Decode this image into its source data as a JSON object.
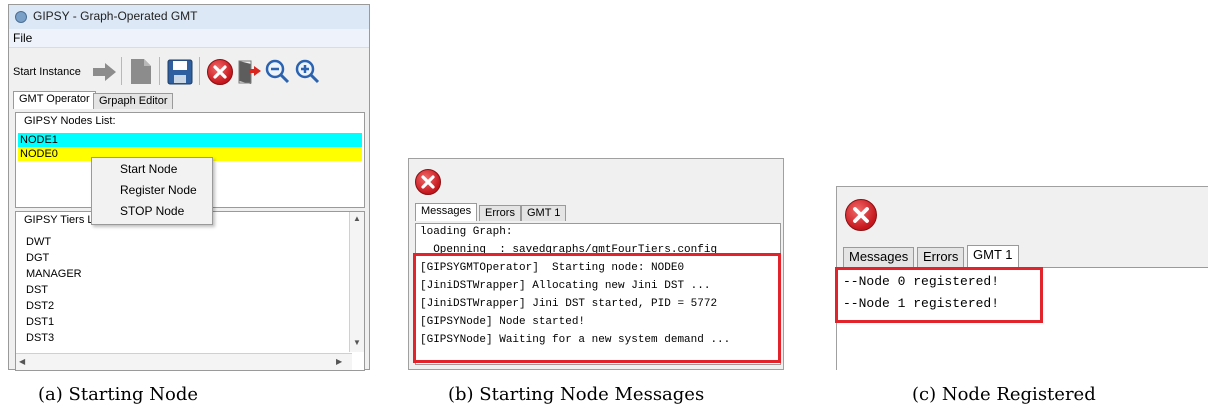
{
  "panel_a": {
    "window_title": "GIPSY - Graph-Operated GMT",
    "menu": [
      "File"
    ],
    "toolbar": {
      "start_instance_label": "Start Instance",
      "icons": [
        "arrow-right-icon",
        "document-icon",
        "save-icon",
        "close-icon",
        "exit-door-icon",
        "zoom-out-icon",
        "zoom-in-icon"
      ]
    },
    "tabs": [
      "GMT Operator",
      "Grpaph Editor"
    ],
    "nodes_list": {
      "title": "GIPSY Nodes List:",
      "items": [
        {
          "label": "NODE1",
          "color": "#00ffff"
        },
        {
          "label": "NODE0",
          "color": "#ffff00"
        }
      ]
    },
    "context_menu": [
      "Start Node",
      "Register Node",
      "STOP Node"
    ],
    "tiers_list": {
      "title": "GIPSY Tiers List:",
      "items": [
        "DWT",
        "DGT",
        "MANAGER",
        "DST",
        "DST2",
        "DST1",
        "DST3"
      ]
    },
    "caption": "(a) Starting Node"
  },
  "panel_b": {
    "tabs": [
      "Messages",
      "Errors",
      "GMT 1"
    ],
    "lines": [
      "loading Graph:",
      "  Openning  : savedgraphs/gmtFourTiers.config",
      "[GIPSYGMTOperator]  Starting node: NODE0",
      "[JiniDSTWrapper] Allocating new Jini DST ...",
      "[JiniDSTWrapper] Jini DST started, PID = 5772",
      "[GIPSYNode] Node started!",
      "[GIPSYNode] Waiting for a new system demand ..."
    ],
    "caption": "(b) Starting Node Messages"
  },
  "panel_c": {
    "tabs": [
      "Messages",
      "Errors",
      "GMT 1"
    ],
    "lines": [
      "--Node 0 registered!",
      "--Node 1 registered!"
    ],
    "caption": "(c) Node Registered"
  },
  "colors": {
    "highlight_red": "#e3232c",
    "node1_bg": "#00ffff",
    "node0_bg": "#ffff00"
  }
}
